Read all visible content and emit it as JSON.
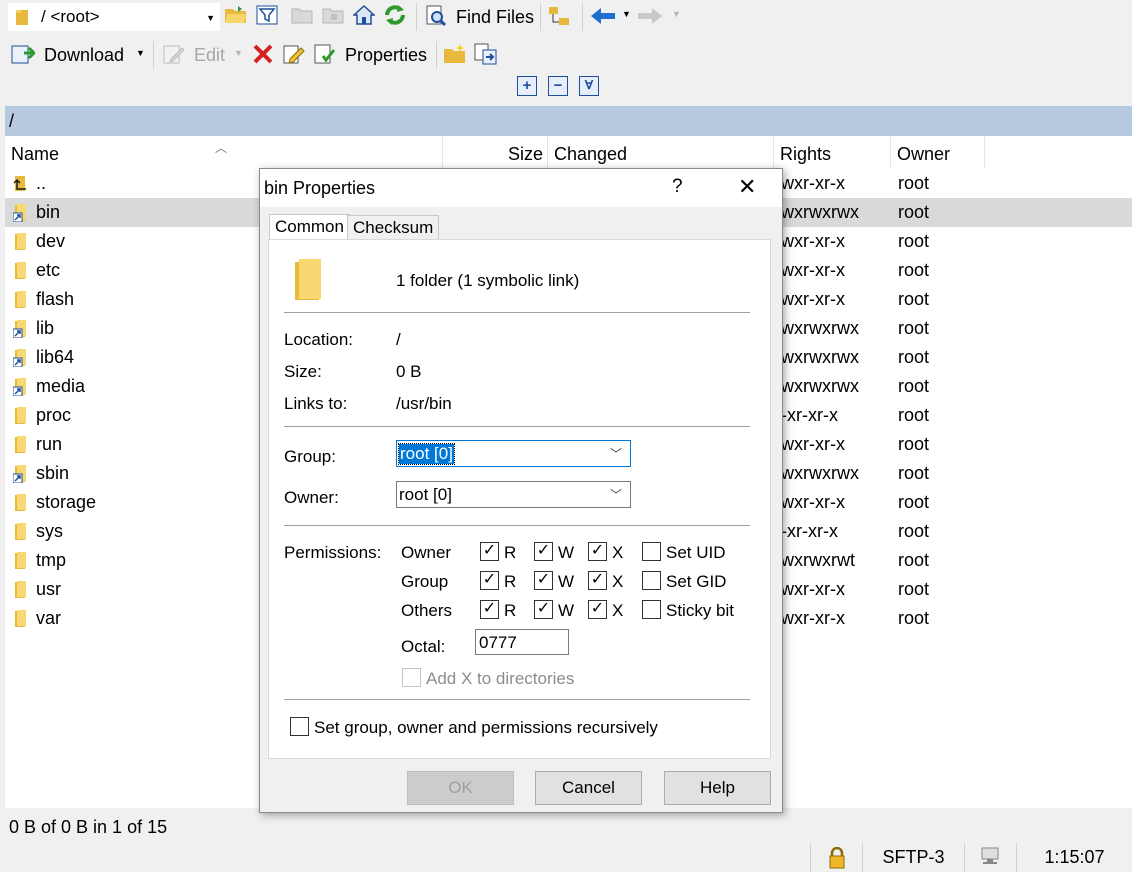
{
  "toolbar": {
    "path_combo": "/ <root>",
    "find_files": "Find Files",
    "download": "Download",
    "edit": "Edit",
    "properties": "Properties"
  },
  "path_bar": "/",
  "columns": {
    "name": "Name",
    "size": "Size",
    "changed": "Changed",
    "rights": "Rights",
    "owner": "Owner"
  },
  "files": [
    {
      "name": "..",
      "rights": "rwxr-xr-x",
      "owner": "root",
      "type": "parent"
    },
    {
      "name": "bin",
      "rights": "rwxrwxrwx",
      "owner": "root",
      "type": "link"
    },
    {
      "name": "dev",
      "rights": "rwxr-xr-x",
      "owner": "root",
      "type": "folder"
    },
    {
      "name": "etc",
      "rights": "rwxr-xr-x",
      "owner": "root",
      "type": "folder"
    },
    {
      "name": "flash",
      "rights": "rwxr-xr-x",
      "owner": "root",
      "type": "folder"
    },
    {
      "name": "lib",
      "rights": "rwxrwxrwx",
      "owner": "root",
      "type": "link"
    },
    {
      "name": "lib64",
      "rights": "rwxrwxrwx",
      "owner": "root",
      "type": "link"
    },
    {
      "name": "media",
      "rights": "rwxrwxrwx",
      "owner": "root",
      "type": "link"
    },
    {
      "name": "proc",
      "rights": "r-xr-xr-x",
      "owner": "root",
      "type": "folder"
    },
    {
      "name": "run",
      "rights": "rwxr-xr-x",
      "owner": "root",
      "type": "folder"
    },
    {
      "name": "sbin",
      "rights": "rwxrwxrwx",
      "owner": "root",
      "type": "link"
    },
    {
      "name": "storage",
      "rights": "rwxr-xr-x",
      "owner": "root",
      "type": "folder"
    },
    {
      "name": "sys",
      "rights": "r-xr-xr-x",
      "owner": "root",
      "type": "folder"
    },
    {
      "name": "tmp",
      "rights": "rwxrwxrwt",
      "owner": "root",
      "type": "folder"
    },
    {
      "name": "usr",
      "rights": "rwxr-xr-x",
      "owner": "root",
      "type": "folder"
    },
    {
      "name": "var",
      "rights": "rwxr-xr-x",
      "owner": "root",
      "type": "folder"
    }
  ],
  "status": {
    "selection": "0 B of 0 B in 1 of 15",
    "protocol": "SFTP-3",
    "time": "1:15:07"
  },
  "dialog": {
    "title": "bin Properties",
    "help_glyph": "?",
    "close_glyph": "✕",
    "tabs": [
      "Common",
      "Checksum"
    ],
    "summary": "1 folder (1 symbolic link)",
    "location_label": "Location:",
    "location_value": "/",
    "size_label": "Size:",
    "size_value": "0 B",
    "links_label": "Links to:",
    "links_value": "/usr/bin",
    "group_label": "Group:",
    "group_value": "root [0]",
    "owner_label": "Owner:",
    "owner_value": "root [0]",
    "permissions_label": "Permissions:",
    "perm_rows": [
      {
        "label": "Owner",
        "r": true,
        "w": true,
        "x": true,
        "special": "Set UID",
        "special_checked": false
      },
      {
        "label": "Group",
        "r": true,
        "w": true,
        "x": true,
        "special": "Set GID",
        "special_checked": false
      },
      {
        "label": "Others",
        "r": true,
        "w": true,
        "x": true,
        "special": "Sticky bit",
        "special_checked": false
      }
    ],
    "r": "R",
    "w": "W",
    "x": "X",
    "octal_label": "Octal:",
    "octal_value": "0777",
    "add_x": "Add X to directories",
    "recursive": "Set group, owner and permissions recursively",
    "ok": "OK",
    "cancel": "Cancel",
    "help": "Help"
  }
}
